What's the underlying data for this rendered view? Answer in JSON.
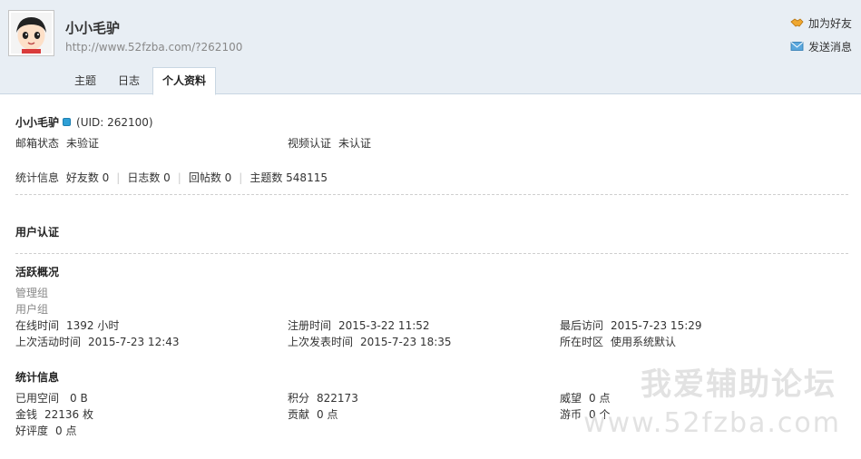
{
  "profile": {
    "username": "小小毛驴",
    "home_url": "http://www.52fzba.com/?262100"
  },
  "actions": {
    "add_friend": "加为好友",
    "send_message": "发送消息"
  },
  "tabs": [
    {
      "label": "主题"
    },
    {
      "label": "日志"
    },
    {
      "label": "个人资料"
    }
  ],
  "basic": {
    "username": "小小毛驴",
    "uid": "(UID: 262100)",
    "email_status_label": "邮箱状态",
    "email_status_value": "未验证",
    "video_label": "视频认证",
    "video_value": "未认证"
  },
  "stats_line": {
    "label": "统计信息",
    "friends": "好友数 0",
    "blogs": "日志数 0",
    "replies": "回帖数 0",
    "threads": "主题数 548115"
  },
  "sections": {
    "auth": "用户认证",
    "activity": "活跃概况",
    "stats": "统计信息"
  },
  "activity": {
    "admin_group": "管理组",
    "user_group": "用户组",
    "online_label": "在线时间",
    "online_value": "1392 小时",
    "reg_label": "注册时间",
    "reg_value": "2015-3-22 11:52",
    "last_visit_label": "最后访问",
    "last_visit_value": "2015-7-23 15:29",
    "last_active_label": "上次活动时间",
    "last_active_value": "2015-7-23 12:43",
    "last_post_label": "上次发表时间",
    "last_post_value": "2015-7-23 18:35",
    "timezone_label": "所在时区",
    "timezone_value": "使用系统默认"
  },
  "stats": {
    "space_label": "已用空间",
    "space_value": "0 B",
    "credits_label": "积分",
    "credits_value": "822173",
    "prestige_label": "威望",
    "prestige_value": "0 点",
    "money_label": "金钱",
    "money_value": "22136 枚",
    "contrib_label": "贡献",
    "contrib_value": "0 点",
    "coins_label": "游币",
    "coins_value": "0 个",
    "rating_label": "好评度",
    "rating_value": "0 点"
  },
  "watermark": {
    "text1": "我爱辅助论坛",
    "text2": "www.52fzba.com"
  },
  "colors": {
    "header_bg": "#e8eef4",
    "badge": "#2fa0d6"
  }
}
